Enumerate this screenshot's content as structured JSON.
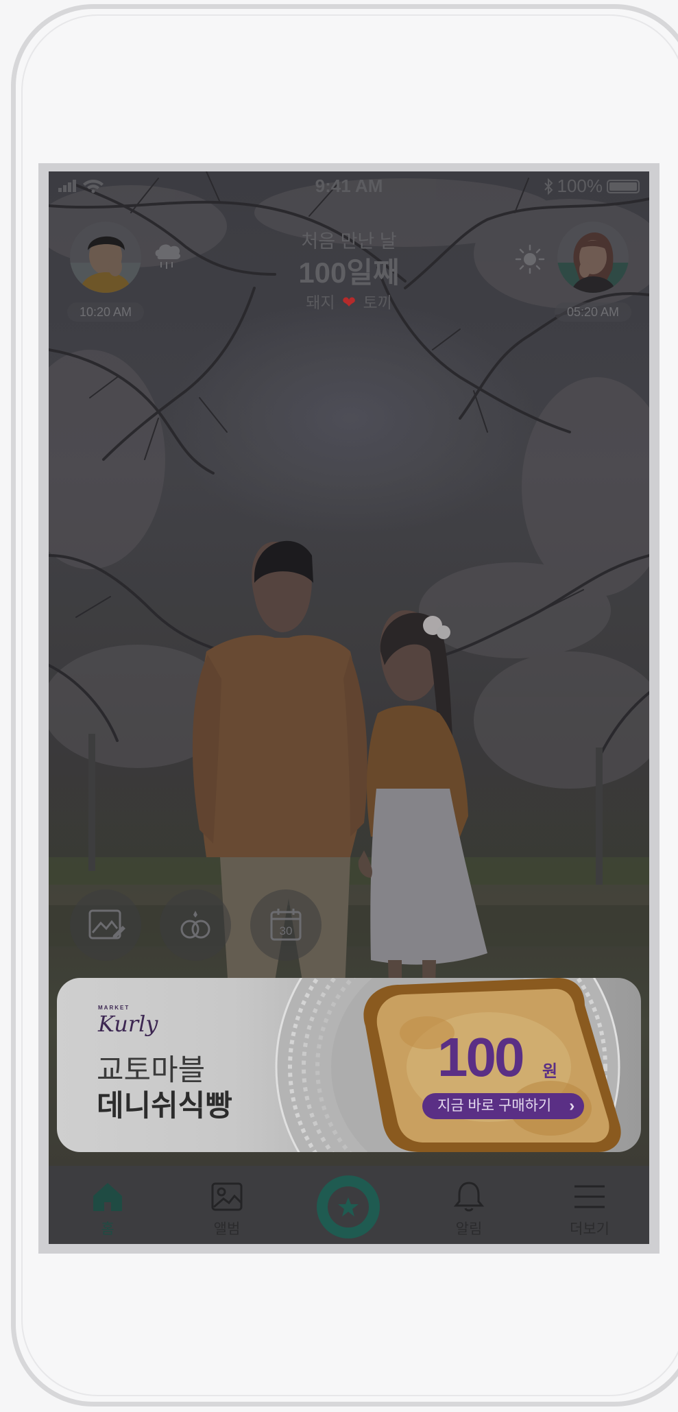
{
  "status_bar": {
    "time": "9:41 AM",
    "battery": "100%"
  },
  "header": {
    "label": "처음 만난 날",
    "count": "100일째",
    "name_left": "돼지",
    "name_right": "토끼"
  },
  "profiles": {
    "left": {
      "time": "10:20 AM",
      "weather_icon": "cloud-rain-icon"
    },
    "right": {
      "time": "05:20 AM",
      "weather_icon": "sun-icon"
    }
  },
  "quick_actions": [
    {
      "icon": "edit-photo-icon"
    },
    {
      "icon": "rings-icon"
    },
    {
      "icon": "calendar-icon",
      "day": "30"
    }
  ],
  "ad": {
    "brand_small": "MARKET",
    "brand": "Kurly",
    "line1": "교토마블",
    "line2": "데니쉬식빵",
    "price": "100",
    "currency": "원",
    "cta": "지금 바로 구매하기"
  },
  "tabs": [
    {
      "label": "홈",
      "icon": "home-icon"
    },
    {
      "label": "앨범",
      "icon": "image-icon"
    },
    {
      "label": "알림",
      "icon": "bell-icon"
    },
    {
      "label": "더보기",
      "icon": "menu-icon"
    }
  ],
  "colors": {
    "accent": "#1f5b51",
    "ad_purple": "#5a2f85",
    "heart": "#b52b2b"
  }
}
